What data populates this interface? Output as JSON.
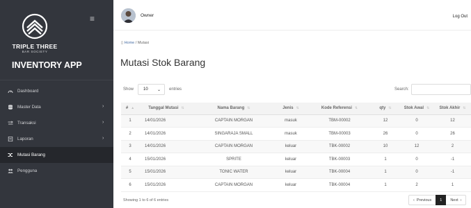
{
  "sidebar": {
    "brand_line1": "TRIPLE THREE",
    "brand_line2": "BAR SOCIETY",
    "app_title": "INVENTORY APP",
    "menu_icon": "hamburger-icon",
    "items": [
      {
        "label": "Dashboard",
        "icon": "gauge-icon",
        "has_submenu": false,
        "active": false
      },
      {
        "label": "Master Data",
        "icon": "database-icon",
        "has_submenu": true,
        "active": false
      },
      {
        "label": "Transaksi",
        "icon": "exchange-icon",
        "has_submenu": true,
        "active": false
      },
      {
        "label": "Laporan",
        "icon": "report-icon",
        "has_submenu": true,
        "active": false
      },
      {
        "label": "Mutasi Barang",
        "icon": "shuffle-icon",
        "has_submenu": false,
        "active": true
      },
      {
        "label": "Pengguna",
        "icon": "users-icon",
        "has_submenu": false,
        "active": false
      }
    ]
  },
  "topbar": {
    "user_name": "Owner",
    "logout_label": "Log Out"
  },
  "breadcrumb": {
    "home": "Home",
    "separator": "/",
    "current": "Mutasi"
  },
  "page_title": "Mutasi Stok Barang",
  "table_controls": {
    "show_label": "Show",
    "entries_value": "10",
    "entries_label": "entries",
    "search_label": "Search:",
    "search_value": ""
  },
  "table": {
    "columns": [
      "#",
      "Tanggal Mutasi",
      "Nama Barang",
      "Jenis",
      "Kode Referensi",
      "qty",
      "Stok Awal",
      "Stok Akhir"
    ],
    "rows": [
      [
        "1",
        "14/01/2026",
        "CAPTAIN MORGAN",
        "masuk",
        "TBM-00002",
        "12",
        "0",
        "12"
      ],
      [
        "2",
        "14/01/2026",
        "SINGARAJA SMALL",
        "masuk",
        "TBM-00003",
        "26",
        "0",
        "26"
      ],
      [
        "3",
        "14/01/2026",
        "CAPTAIN MORGAN",
        "keluar",
        "TBK-00002",
        "10",
        "12",
        "2"
      ],
      [
        "4",
        "15/01/2026",
        "SPRITE",
        "keluar",
        "TBK-00003",
        "1",
        "0",
        "-1"
      ],
      [
        "5",
        "15/01/2026",
        "TONIC WATER",
        "keluar",
        "TBK-00004",
        "1",
        "0",
        "-1"
      ],
      [
        "6",
        "15/01/2026",
        "CAPTAIN MORGAN",
        "keluar",
        "TBK-00004",
        "1",
        "2",
        "1"
      ]
    ]
  },
  "footer": {
    "info": "Showing 1 to 6 of 6 entries",
    "prev_label": "Previous",
    "current_page": "1",
    "next_label": "Next"
  },
  "colors": {
    "sidebar_bg": "#33363d",
    "sidebar_active_bg": "#25272c",
    "pager_active": "#222222"
  }
}
